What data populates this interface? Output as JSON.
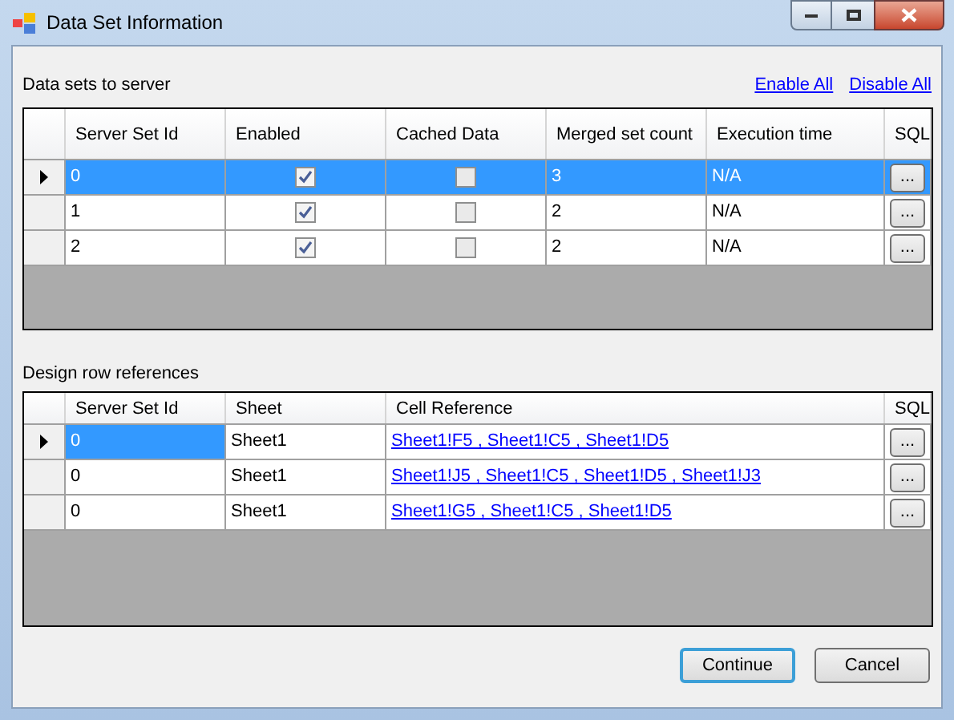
{
  "window": {
    "title": "Data Set Information"
  },
  "data_sets": {
    "label": "Data sets to server",
    "links": [
      "Enable All",
      "Disable All"
    ],
    "columns": [
      "Server Set Id",
      "Enabled",
      "Cached Data",
      "Merged set count",
      "Execution time",
      "SQL"
    ],
    "rows": [
      {
        "selected": true,
        "id": "0",
        "enabled": true,
        "cached": false,
        "merged": "3",
        "execution_time": "N/A",
        "sql_button": "..."
      },
      {
        "selected": false,
        "id": "1",
        "enabled": true,
        "cached": false,
        "merged": "2",
        "execution_time": "N/A",
        "sql_button": "..."
      },
      {
        "selected": false,
        "id": "2",
        "enabled": true,
        "cached": false,
        "merged": "2",
        "execution_time": "N/A",
        "sql_button": "..."
      }
    ]
  },
  "design_rows": {
    "label": "Design row references",
    "columns": [
      "Server Set Id",
      "Sheet",
      "Cell Reference",
      "SQL"
    ],
    "rows": [
      {
        "selected": true,
        "id_cell_selected": true,
        "id": "0",
        "sheet": "Sheet1",
        "cell_reference": "Sheet1!F5 , Sheet1!C5 , Sheet1!D5",
        "sql_button": "..."
      },
      {
        "selected": false,
        "id_cell_selected": false,
        "id": "0",
        "sheet": "Sheet1",
        "cell_reference": "Sheet1!J5 , Sheet1!C5 , Sheet1!D5 , Sheet1!J3",
        "sql_button": "..."
      },
      {
        "selected": false,
        "id_cell_selected": false,
        "id": "0",
        "sheet": "Sheet1",
        "cell_reference": "Sheet1!G5 , Sheet1!C5 , Sheet1!D5",
        "sql_button": "..."
      }
    ]
  },
  "buttons": [
    {
      "label": "Continue",
      "default": true
    },
    {
      "label": "Cancel",
      "default": false
    }
  ]
}
